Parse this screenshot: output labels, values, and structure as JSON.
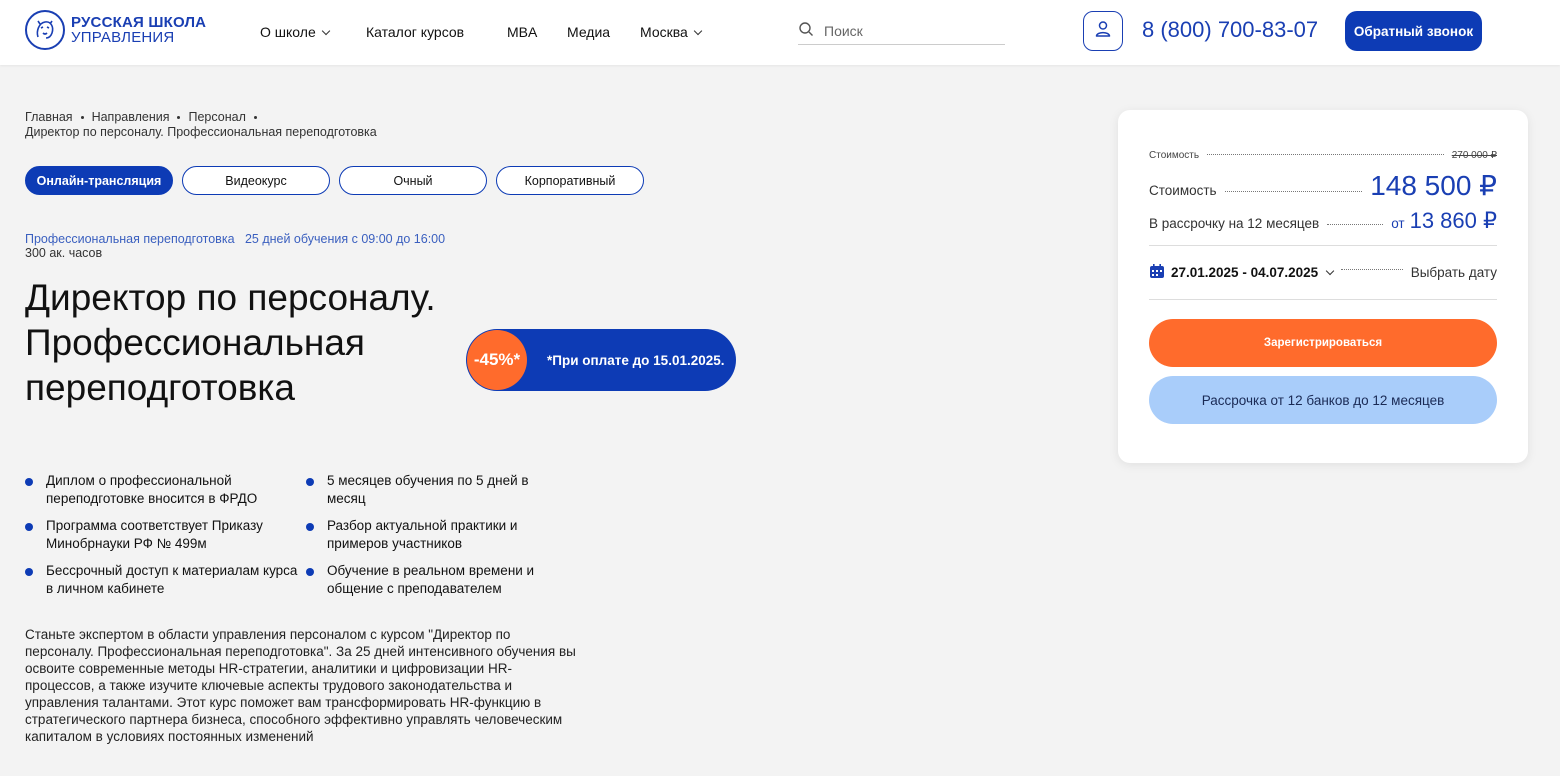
{
  "header": {
    "logo_line1": "РУССКАЯ ШКОЛА",
    "logo_line2": "УПРАВЛЕНИЯ",
    "nav": {
      "about": "О школе",
      "catalog": "Каталог курсов",
      "mba": "MBA",
      "media": "Медиа",
      "city": "Москва"
    },
    "search_placeholder": "Поиск",
    "phone": "8 (800) 700-83-07",
    "callback": "Обратный звонок"
  },
  "breadcrumbs": {
    "home": "Главная",
    "directions": "Направления",
    "personnel": "Персонал",
    "current": "Директор по персоналу. Профессиональная переподготовка"
  },
  "formats": {
    "online": "Онлайн-трансляция",
    "video": "Видеокурс",
    "offline": "Очный",
    "corporate": "Корпоративный"
  },
  "meta": {
    "type": "Профессиональная переподготовка",
    "schedule": "25 дней обучения с 09:00 до 16:00",
    "hours": "300 ак. часов"
  },
  "title": "Директор по персоналу. Профессиональная переподготовка",
  "promo": {
    "discount": "-45%*",
    "note": "*При оплате до 15.01.2025."
  },
  "features": [
    "Диплом о профессиональной переподготовке вносится в ФРДО",
    "5 месяцев обучения по 5 дней в месяц",
    "Программа соответствует Приказу Минобрнауки РФ № 499м",
    "Разбор актуальной практики и примеров участников",
    "Бессрочный доступ к материалам курса в личном кабинете",
    "Обучение в реальном времени и общение с преподавателем"
  ],
  "description": "Станьте экспертом в области управления персоналом с курсом \"Директор по персоналу. Профессиональная переподготовка\". За 25 дней интенсивного обучения вы освоите современные методы HR-стратегии, аналитики и цифровизации HR-процессов, а также изучите ключевые аспекты трудового законодательства и управления талантами. Этот курс поможет вам трансформировать HR-функцию в стратегического партнера бизнеса, способного эффективно управлять человеческим капиталом в условиях постоянных изменений",
  "pricing": {
    "old_label": "Стоимость",
    "old_price": "270 000 ₽",
    "label": "Стоимость",
    "price": "148 500 ₽",
    "installment_label": "В рассрочку на 12 месяцев",
    "installment_from": "от",
    "installment_price": "13 860 ₽",
    "dates": "27.01.2025 - 04.07.2025",
    "choose_date": "Выбрать дату",
    "register": "Зарегистрироваться",
    "credit": "Рассрочка от 12 банков до 12 месяцев"
  },
  "colors": {
    "brand_blue": "#0d3bb5",
    "accent_orange": "#ff6b2c",
    "light_blue": "#a9cdfa"
  }
}
